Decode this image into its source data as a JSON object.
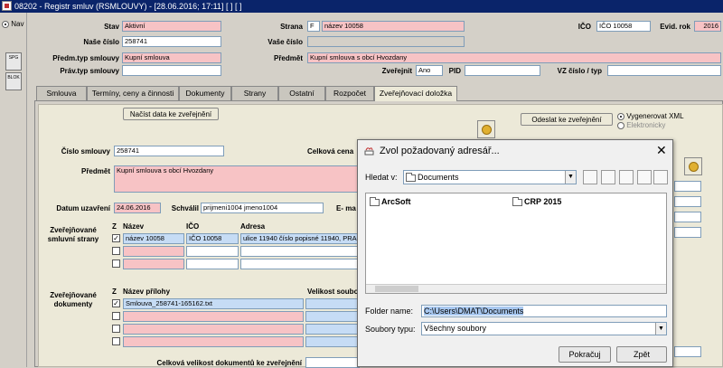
{
  "window": {
    "title": "08202 - Registr smluv (RSMLOUVY) - [28.06.2016; 17:11] [ ] [ ]"
  },
  "sidebar": {
    "nav_label": "Nav",
    "icons": [
      "SPG",
      "BLOK"
    ]
  },
  "header": {
    "stav_label": "Stav",
    "stav_value": "Aktivní",
    "strana_label": "Strana",
    "strana_code": "F",
    "strana_value": "název 10058",
    "ico_label": "IČO",
    "ico_value": "IČO 10058",
    "evid_label": "Evid. rok",
    "evid_value": "2016",
    "nase_label": "Naše číslo",
    "nase_value": "258741",
    "vase_label": "Vaše číslo",
    "vase_value": "",
    "predm_typ_label": "Předm.typ smlouvy",
    "predm_typ_value": "Kupní smlouva",
    "predmet_label": "Předmět",
    "predmet_value": "Kupní smlouva s obcí Hvozdany",
    "prav_typ_label": "Práv.typ smlouvy",
    "prav_typ_value": "",
    "zverejnit_label": "Zveřejnit",
    "zverejnit_value": "Ano",
    "pid_label": "PID",
    "pid_value": "",
    "vz_label": "VZ číslo / typ",
    "vz_value": ""
  },
  "tabs": [
    {
      "label": "Smlouva"
    },
    {
      "label": "Termíny, ceny a činnosti"
    },
    {
      "label": "Dokumenty"
    },
    {
      "label": "Strany"
    },
    {
      "label": "Ostatní"
    },
    {
      "label": "Rozpočet"
    },
    {
      "label": "Zveřejňovací doložka"
    }
  ],
  "form": {
    "load_button": "Načíst data ke zveřejnění",
    "send_button": "Odeslat ke zveřejnění",
    "gen_xml": "Vygenerovat XML",
    "electronic": "Elektronicky",
    "cislo_label": "Číslo smlouvy",
    "cislo_value": "258741",
    "celkova_label": "Celková cena",
    "predmet_label": "Předmět",
    "predmet_value": "Kupní smlouva s obcí Hvozdany",
    "datum_label": "Datum uzavření",
    "datum_value": "24.06.2016",
    "schvalil_label": "Schválil",
    "schvalil_value": "prijmeni1004 jmeno1004",
    "email_label": "E- ma",
    "strany_label": "Zveřejňované smluvní strany",
    "strany_cols": {
      "z": "Z",
      "nazev": "Název",
      "ico": "IČO",
      "adresa": "Adresa"
    },
    "strany_row": {
      "nazev": "název 10058",
      "ico": "IČO 10058",
      "adresa": "ulice 11940 číslo popisné 11940, PRA"
    },
    "dok_label": "Zveřejňované dokumenty",
    "dok_cols": {
      "z": "Z",
      "nazev": "Název přílohy",
      "velikost": "Velikost soubor"
    },
    "dok_row": {
      "nazev": "Smlouva_258741-165162.txt"
    },
    "celkova_velikost": "Celková velikost dokumentů ke zveřejnění"
  },
  "dialog": {
    "title": "Zvol požadovaný adresář...",
    "lookin_label": "Hledat v:",
    "lookin_value": "Documents",
    "items": [
      "ArcSoft",
      "CRP 2015"
    ],
    "folder_label": "Folder name:",
    "folder_value": "C:\\Users\\DMAT\\Documents",
    "types_label": "Soubory typu:",
    "types_value": "Všechny soubory",
    "ok_button": "Pokračuj",
    "back_button": "Zpět"
  }
}
